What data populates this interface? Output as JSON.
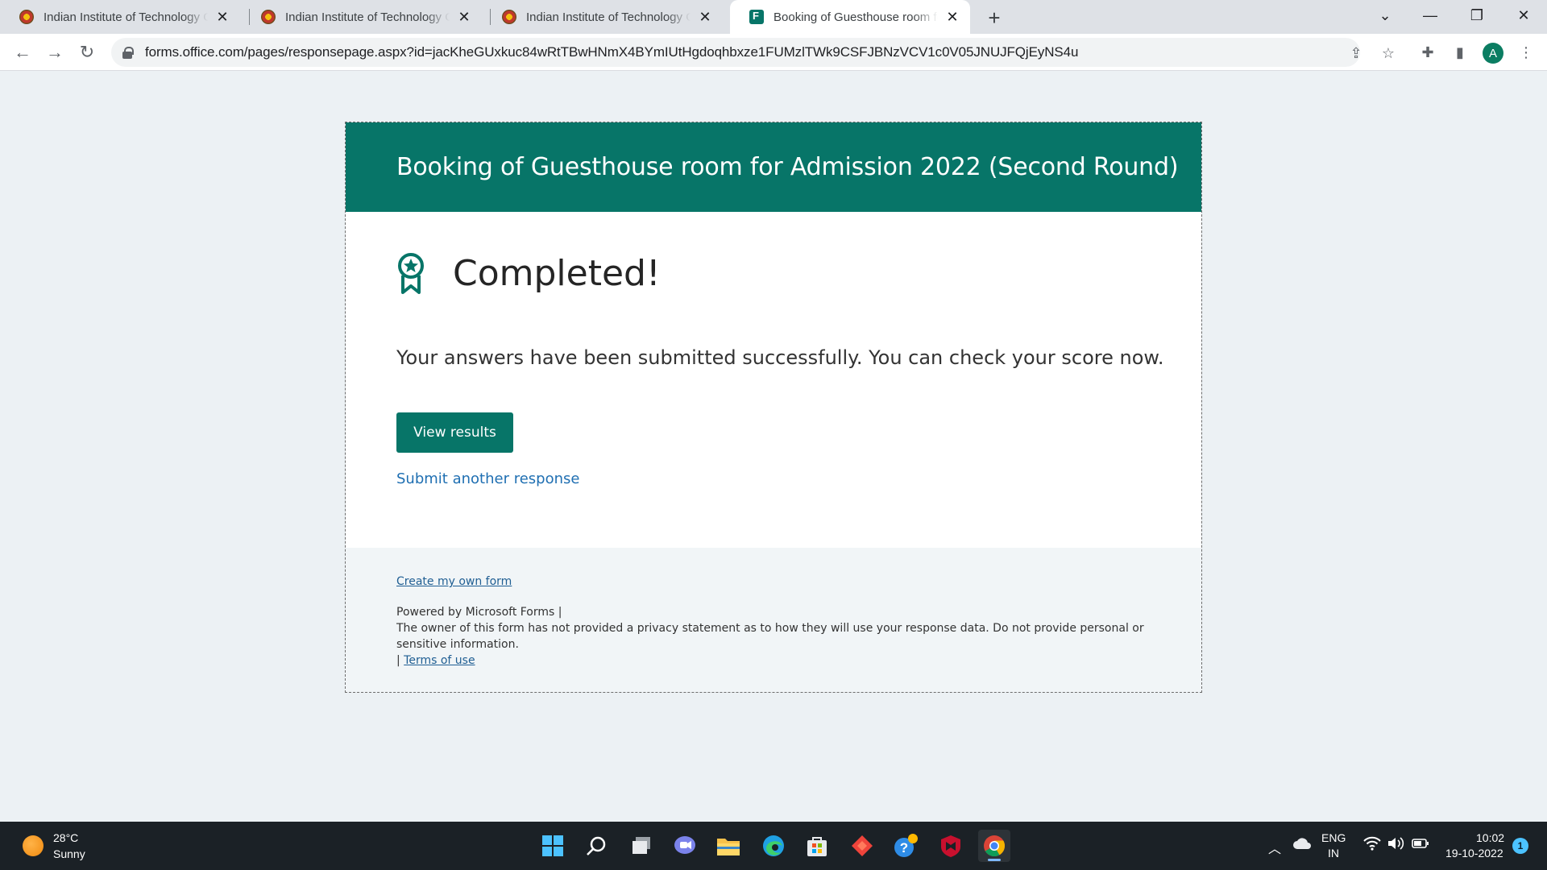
{
  "browser": {
    "tabs": [
      {
        "title": "Indian Institute of Technology Gu",
        "icon": "iit-logo-icon",
        "active": false
      },
      {
        "title": "Indian Institute of Technology Gu",
        "icon": "iit-logo-icon",
        "active": false
      },
      {
        "title": "Indian Institute of Technology Gu",
        "icon": "iit-logo-icon",
        "active": false
      },
      {
        "title": "Booking of Guesthouse room for",
        "icon": "ms-forms-icon",
        "active": true
      }
    ],
    "url": "forms.office.com/pages/responsepage.aspx?id=jacKheGUxkuc84wRtTBwHNmX4BYmIUtHgdoqhbxze1FUMzlTWk9CSFJBNzVCV1c0V05JNUJFQjEyNS4u",
    "profile_initial": "A"
  },
  "form": {
    "title": "Booking of Guesthouse room for Admission 2022 (Second Round)",
    "completed_heading": "Completed!",
    "success_message": "Your answers have been submitted successfully. You can check your score now.",
    "view_results_label": "View results",
    "submit_another_label": "Submit another response",
    "accent_color": "#077568"
  },
  "footer": {
    "create_link": "Create my own form",
    "powered_by": "Powered by Microsoft Forms |",
    "privacy_notice": "The owner of this form has not provided a privacy statement as to how they will use your response data. Do not provide personal or sensitive information.",
    "terms_prefix": "| ",
    "terms_link": "Terms of use"
  },
  "taskbar": {
    "weather_temp": "28°C",
    "weather_desc": "Sunny",
    "language": "ENG",
    "region": "IN",
    "time": "10:02",
    "date": "19-10-2022",
    "notification_count": "1"
  }
}
